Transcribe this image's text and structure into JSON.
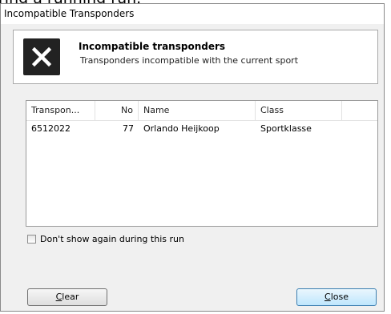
{
  "background_text": "ring a running run.",
  "window": {
    "title": "Incompatible Transponders"
  },
  "header": {
    "title": "Incompatible transponders",
    "subtitle": "Transponders incompatible with the current sport",
    "icon": "close-x-icon"
  },
  "list": {
    "columns": [
      "Transpon...",
      "No",
      "Name",
      "Class"
    ],
    "rows": [
      {
        "transponder": "6512022",
        "no": "77",
        "name": "Orlando Heijkoop",
        "class": "Sportklasse"
      }
    ]
  },
  "options": {
    "dont_show_again_label": "Don't show again during this run",
    "dont_show_again_checked": false
  },
  "buttons": {
    "clear_accel": "C",
    "clear_rest": "lear",
    "close_accel": "C",
    "close_rest": "lose"
  }
}
